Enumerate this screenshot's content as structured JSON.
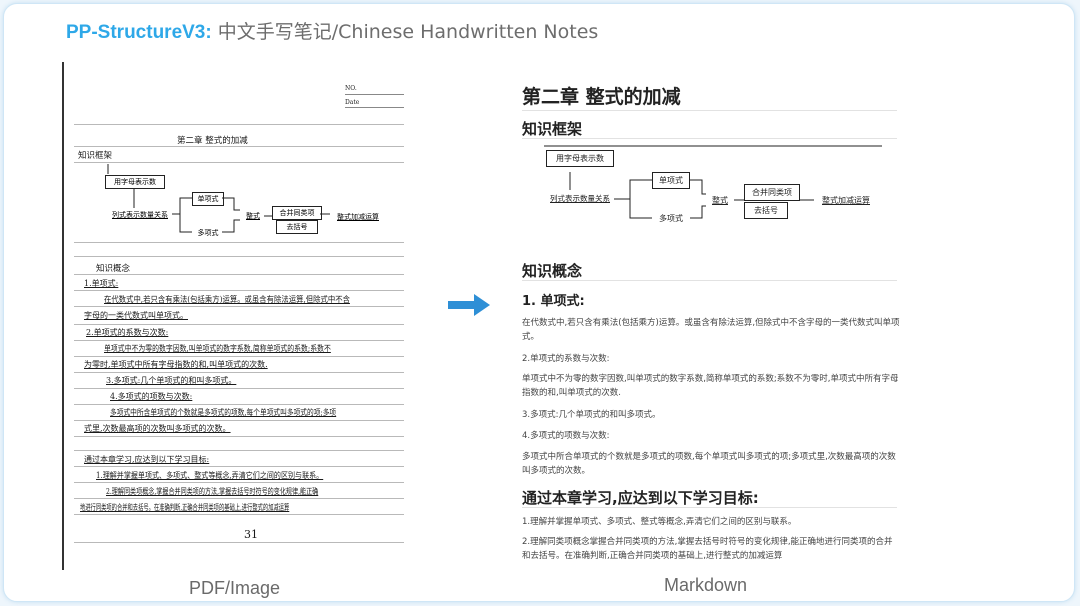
{
  "header": {
    "brand": "PP-StructureV3:",
    "subtitle": "中文手写笔记/Chinese Handwritten Notes"
  },
  "left_panel": {
    "label": "PDF/Image",
    "no_label": "NO.",
    "date_label": "Date",
    "title": "第二章  整式的加减",
    "section1": "知识框架",
    "diagram": {
      "n1": "用字母表示数",
      "n2": "列式表示数量关系",
      "n3": "单项式",
      "n4": "多项式",
      "n5": "整式",
      "n6": "合并同类项",
      "n7": "去括号",
      "n8": "整式加减运算"
    },
    "section2": "知识概念",
    "lines": [
      "1.单项式:",
      "在代数式中,若只含有乘法(包括乘方)运算。或虽含有除法运算,但除式中不含",
      "字母的一类代数式叫单项式。",
      "2.单项式的系数与次数:",
      "单项式中不为零的数字因数,叫单项式的数字系数,简称单项式的系数;系数不",
      "为零时,单项式中所有字母指数的和,叫单项式的次数.",
      "3.多项式:几个单项式的和叫多项式。",
      "4.多项式的项数与次数:",
      "多项式中所含单项式的个数就是多项式的项数,每个单项式叫多项式的项;多项",
      "式里,次数最高项的次数叫多项式的次数。",
      "通过本章学习,应达到以下学习目标:",
      "1.理解并掌握单项式、多项式、整式等概念,弄清它们之间的区别与联系。",
      "2.理解同类项概念,掌握合并同类项的方法,掌握去括号时符号的变化规律,能正确",
      "地进行同类项的合并和去括号。在准确判断,正确合并同类项的基础上,进行整式的加减运算"
    ],
    "page_number": "31"
  },
  "right_panel": {
    "label": "Markdown",
    "h1": "第二章 整式的加减",
    "h2_framework": "知识框架",
    "h2_concepts": "知识概念",
    "h3_mono": "1. 单项式:",
    "p1": "在代数式中,若只含有乘法(包括乘方)运算。或虽含有除法运算,但除式中不含字母的一类代数式叫单项式。",
    "p2": "2.单项式的系数与次数:",
    "p3": "单项式中不为零的数字因数,叫单项式的数字系数,简称单项式的系数;系数不为零时,单项式中所有字母指数的和,叫单项式的次数.",
    "p4": "3.多项式:几个单项式的和叫多项式。",
    "p5": "4.多项式的项数与次数:",
    "p6": "多项式中所合单项式的个数就是多项式的项数,每个单项式叫多项式的项;多项式里,次数最高项的次数叫多项式的次数。",
    "h2_goals": "通过本章学习,应达到以下学习目标:",
    "p7": "1.理解并掌握单项式、多项式、整式等概念,弄清它们之间的区别与联系。",
    "p8": "2.理解同类项概念掌握合并同类项的方法,掌握去括号时符号的变化规律,能正确地进行同类项的合并和去括号。在准确判断,正确合并同类项的基础上,进行整式的加减运算"
  },
  "colors": {
    "brand": "#2ea8e8",
    "arrow": "#2e8fd6",
    "frame_border": "#cfe6f6"
  },
  "icons": {
    "arrow": "right-arrow-icon"
  }
}
